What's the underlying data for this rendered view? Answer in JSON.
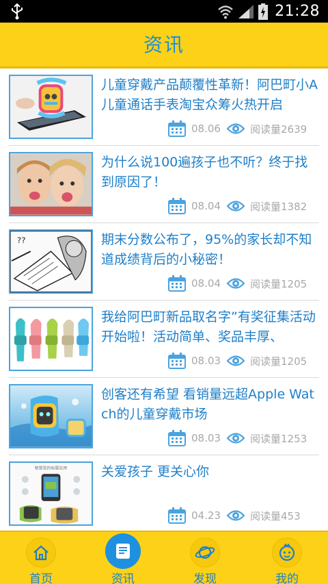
{
  "status_bar": {
    "time": "21:28"
  },
  "header": {
    "title": "资讯"
  },
  "articles": [
    {
      "title": "儿童穿戴产品颠覆性革新！阿巴町小A儿童通话手表淘宝众筹火热开启",
      "date": "08.06",
      "views": "阅读量2639",
      "image": "smartwatch-on-phone"
    },
    {
      "title": "为什么说100遍孩子也不听？终于找到原因了！",
      "date": "08.04",
      "views": "阅读量1382",
      "image": "kids-making-faces"
    },
    {
      "title": "期末分数公布了，95%的家长却不知道成绩背后的小秘密！",
      "date": "08.04",
      "views": "阅读量1205",
      "image": "exam-cartoon"
    },
    {
      "title": "我给阿巴町新品取名字”有奖征集活动开始啦！活动简单、奖品丰厚、",
      "date": "08.03",
      "views": "阅读量1205",
      "image": "colorful-watches"
    },
    {
      "title": "创客还有希望 看销量远超Apple Watch的儿童穿戴市场",
      "date": "08.03",
      "views": "阅读量1253",
      "image": "watch-splash"
    },
    {
      "title": "关爱孩子 更关心你",
      "date": "04.23",
      "views": "阅读量453",
      "image": "watch-infographic",
      "image_caption": "智慧型的拓展应用"
    }
  ],
  "bottom_nav": [
    {
      "label": "首页",
      "icon": "home-icon",
      "active": false
    },
    {
      "label": "资讯",
      "icon": "news-icon",
      "active": true
    },
    {
      "label": "发现",
      "icon": "planet-icon",
      "active": false
    },
    {
      "label": "我的",
      "icon": "face-icon",
      "active": false
    }
  ],
  "colors": {
    "accent_yellow": "#fcd117",
    "accent_blue": "#1e8fd6",
    "meta_gray": "#a8a8a8"
  }
}
